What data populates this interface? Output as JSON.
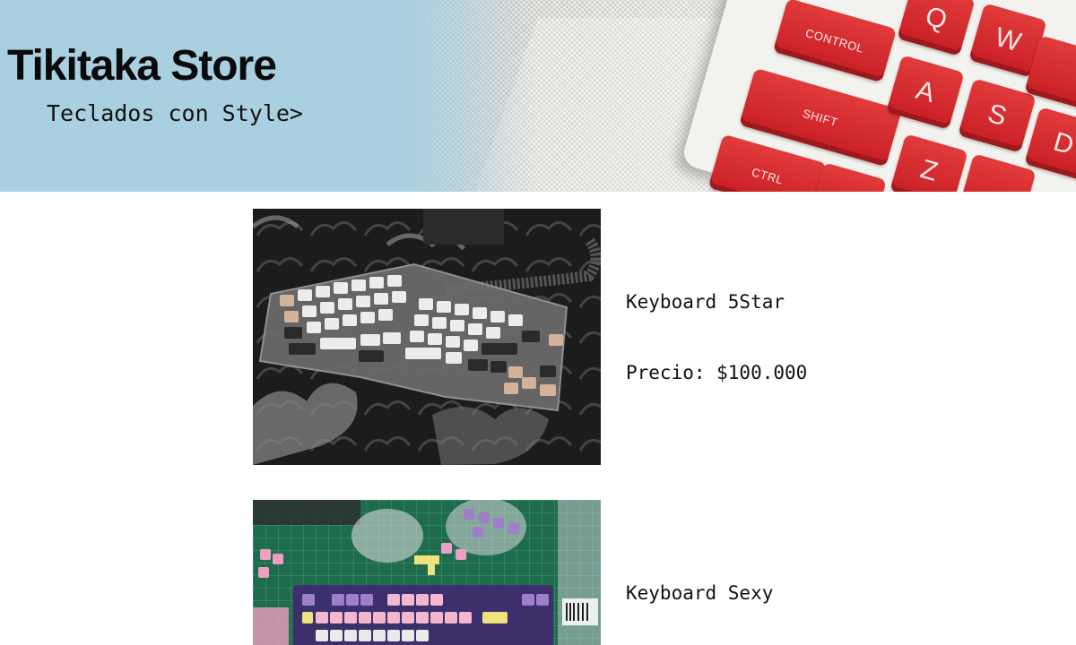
{
  "header": {
    "store_name": "Tikitaka Store",
    "tagline": "Teclados con Style>",
    "banner_keys": [
      "CONTROL",
      "SHIFT",
      "CTRL",
      "Q",
      "W",
      "A",
      "S",
      "Z",
      "D"
    ],
    "colors": {
      "sky": "#a9d0e0",
      "keycap_red": "#d42a2f"
    }
  },
  "products": [
    {
      "name": "Keyboard 5Star",
      "price": "Precio: $100.000",
      "image_icon": "keyboard-photo"
    },
    {
      "name": "Keyboard Sexy",
      "image_icon": "keyboard-photo"
    }
  ]
}
